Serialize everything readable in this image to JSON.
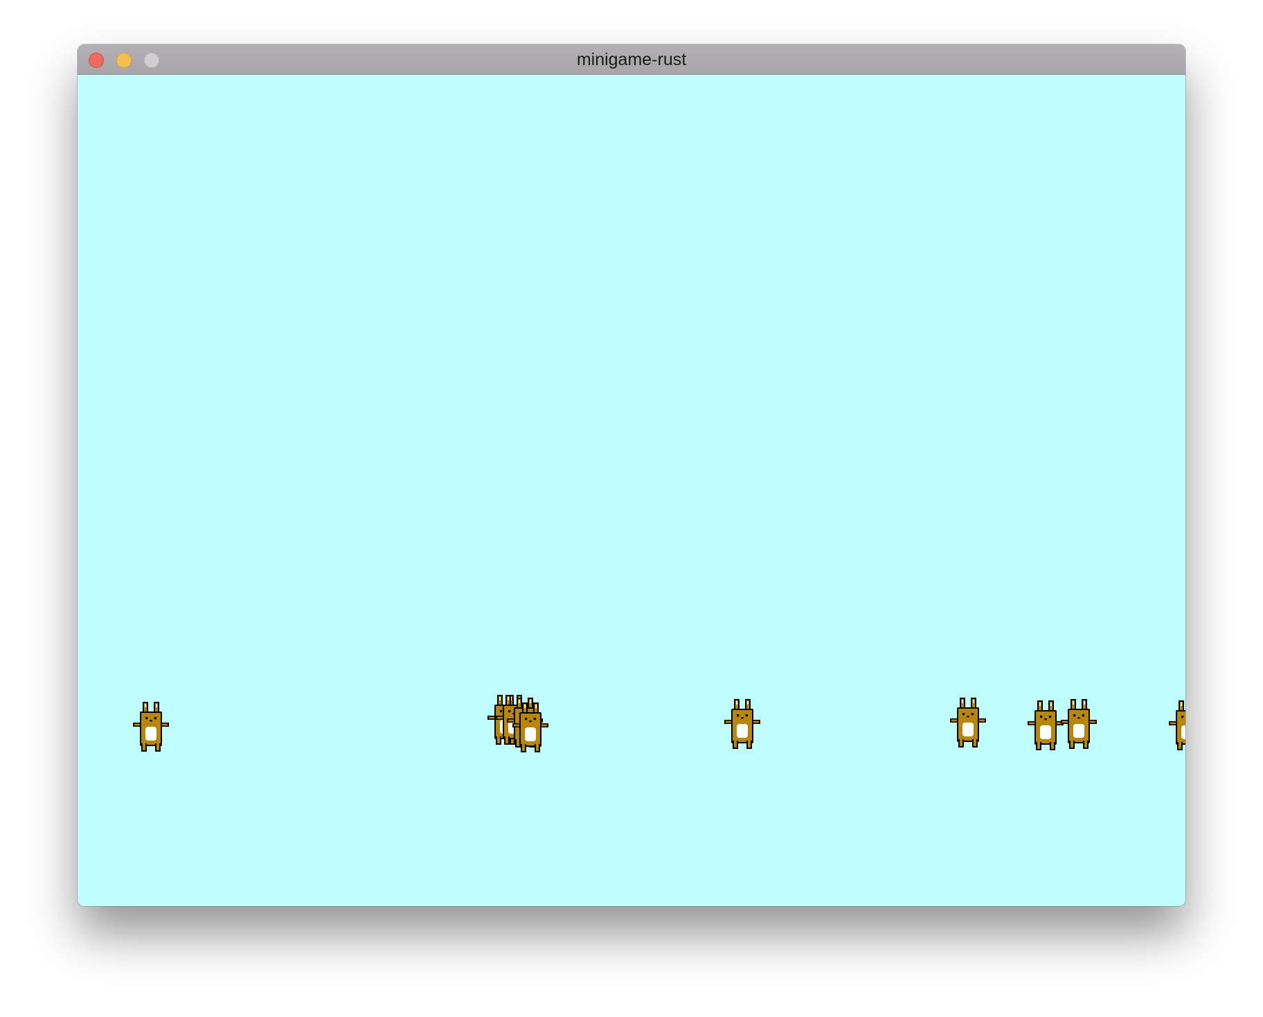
{
  "window": {
    "title": "minigame-rust"
  },
  "controls": {
    "close": "close-button",
    "minimize": "minimize-button",
    "zoom": "zoom-button"
  },
  "scene": {
    "background_color": "#c0ffff",
    "sprite_fill_color": "#b8860b",
    "sprite_belly_color": "#ffffff",
    "sprite_outline_color": "#000000",
    "bunny_count": 11
  }
}
